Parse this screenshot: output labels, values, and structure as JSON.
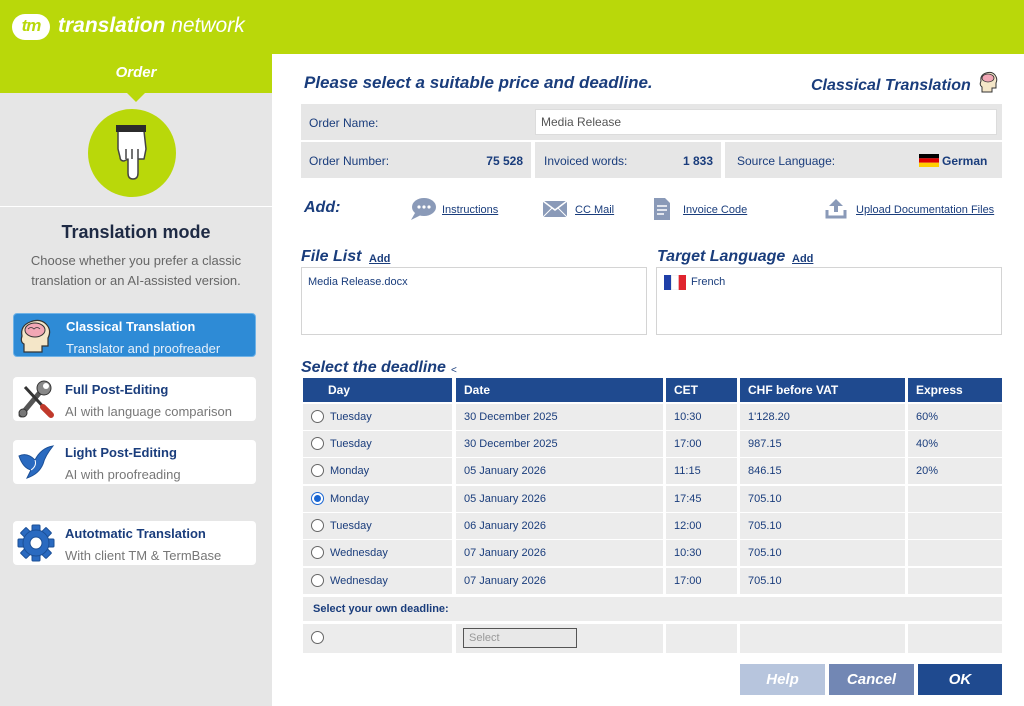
{
  "brand": {
    "logo_mark": "tm",
    "name_bold": "translation",
    "name_light": "network"
  },
  "sidebar": {
    "order_tab": "Order",
    "mode_title": "Translation mode",
    "mode_desc": "Choose whether you prefer a classic translation or an AI-assisted version.",
    "modes": [
      {
        "title": "Classical Translation",
        "subtitle": "Translator and proofreader",
        "icon": "brain-head-icon",
        "active": true
      },
      {
        "title": "Full Post-Editing",
        "subtitle": "AI with language comparison",
        "icon": "wrench-screwdriver-icon",
        "active": false
      },
      {
        "title": "Light Post-Editing",
        "subtitle": "AI with proofreading",
        "icon": "bird-icon",
        "active": false
      },
      {
        "title": "Autotmatic Translation",
        "subtitle": "With client TM & TermBase",
        "icon": "gear-icon",
        "active": false
      }
    ]
  },
  "main": {
    "title": "Please select a suitable price and deadline.",
    "mode_label": "Classical Translation",
    "order_name_label": "Order Name:",
    "order_name_value": "Media Release",
    "order_number_label": "Order Number:",
    "order_number_value": "75 528",
    "invoiced_words_label": "Invoiced words:",
    "invoiced_words_value": "1 833",
    "source_language_label": "Source Language:",
    "source_language_value": "German",
    "add_label": "Add:",
    "add_links": {
      "instructions": "Instructions",
      "cc_mail": "CC Mail",
      "invoice_code": "Invoice Code",
      "upload": "Upload Documentation Files"
    },
    "file_list_title": "File List",
    "file_list_add": "Add",
    "files": [
      "Media Release.docx"
    ],
    "target_language_title": "Target Language",
    "target_language_add": "Add",
    "target_languages": [
      "French"
    ],
    "deadline_title": "Select the deadline",
    "deadline_marker": "<",
    "table_headers": {
      "day": "Day",
      "date": "Date",
      "cet": "CET",
      "chf": "CHF  before VAT",
      "express": "Express"
    },
    "deadlines": [
      {
        "day": "Tuesday",
        "date": "30 December 2025",
        "cet": "10:30",
        "chf": "1'128.20",
        "express": "60%",
        "selected": false
      },
      {
        "day": "Tuesday",
        "date": "30 December 2025",
        "cet": "17:00",
        "chf": "987.15",
        "express": "40%",
        "selected": false
      },
      {
        "day": "Monday",
        "date": "05 January 2026",
        "cet": "11:15",
        "chf": "846.15",
        "express": "20%",
        "selected": false
      },
      {
        "day": "Monday",
        "date": "05 January 2026",
        "cet": "17:45",
        "chf": "705.10",
        "express": "",
        "selected": true
      },
      {
        "day": "Tuesday",
        "date": "06 January 2026",
        "cet": "12:00",
        "chf": "705.10",
        "express": "",
        "selected": false
      },
      {
        "day": "Wednesday",
        "date": "07 January 2026",
        "cet": "10:30",
        "chf": "705.10",
        "express": "",
        "selected": false
      },
      {
        "day": "Wednesday",
        "date": "07 January 2026",
        "cet": "17:00",
        "chf": "705.10",
        "express": "",
        "selected": false
      }
    ],
    "own_deadline_label": "Select your own deadline:",
    "own_deadline_placeholder": "Select",
    "buttons": {
      "help": "Help",
      "cancel": "Cancel",
      "ok": "OK"
    }
  },
  "colors": {
    "brand_green": "#b9d80a",
    "navy": "#1a3d7c",
    "header_blue": "#1f4a8f",
    "active_blue": "#2e8bd6",
    "help_btn": "#b7c5dd",
    "cancel_btn": "#7287b4",
    "ok_btn": "#1f4a8f"
  }
}
